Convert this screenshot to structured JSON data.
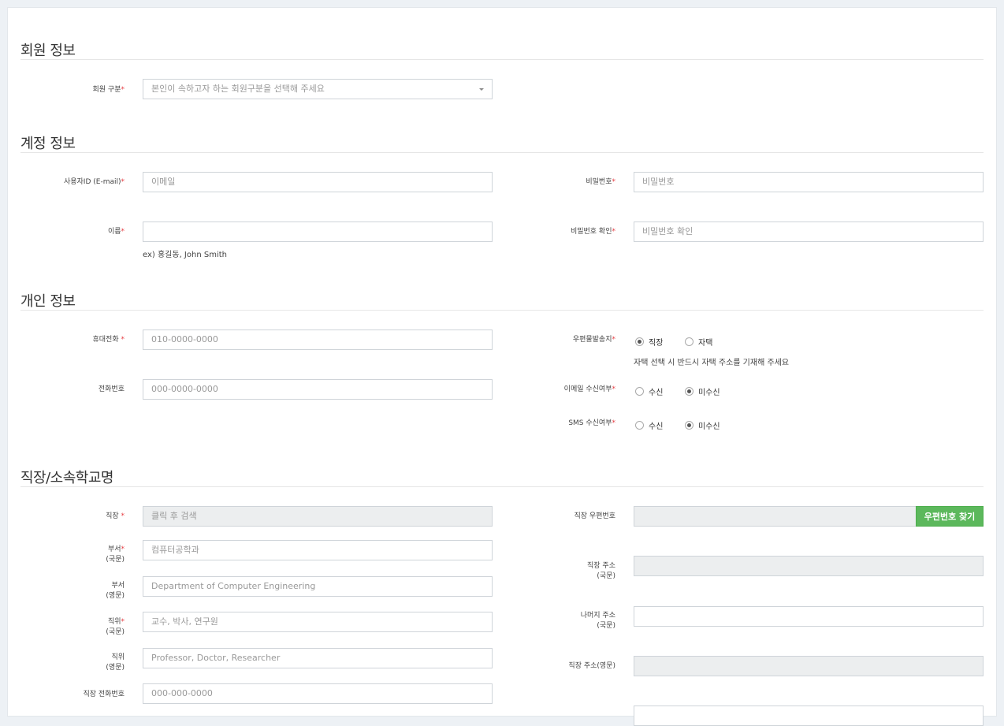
{
  "req_mark": "*",
  "sections": {
    "member": "회원 정보",
    "account": "계정 정보",
    "personal": "개인 정보",
    "workplace": "직장/소속학교명"
  },
  "member": {
    "type_label": "회원 구분",
    "type_select": "본인이 속하고자 하는 회원구분을 선택해 주세요"
  },
  "account": {
    "id_label": "사용자ID (E-mail)",
    "id_placeholder": "이메일",
    "name_label": "이름",
    "name_value": "",
    "name_hint": "ex) 홍길동, John Smith",
    "pw_label": "비밀번호",
    "pw_placeholder": "비밀번호",
    "pw_confirm_label": "비밀번호 확인",
    "pw_confirm_placeholder": "비밀번호 확인"
  },
  "personal": {
    "mobile_label": "휴대전화",
    "mobile_placeholder": "010-0000-0000",
    "phone_label": "전화번호",
    "phone_placeholder": "000-0000-0000",
    "mail_dest_label": "우편물발송지",
    "mail_dest_options": [
      "직장",
      "자택"
    ],
    "mail_dest_hint": "자택 선택 시 반드시 자택 주소를 기재해 주세요",
    "email_recv_label": "이메일 수신여부",
    "sms_recv_label": "SMS 수신여부",
    "recv_options": [
      "수신",
      "미수신"
    ]
  },
  "workplace": {
    "company_label": "직장",
    "company_placeholder": "클릭 후 검색",
    "dept_kr_label": "부서",
    "dept_kr_sub": "(국문)",
    "dept_kr_placeholder": "컴퓨터공학과",
    "dept_en_label": "부서",
    "dept_en_sub": "(영문)",
    "dept_en_placeholder": "Department of Computer Engineering",
    "pos_kr_label": "직위",
    "pos_kr_sub": "(국문)",
    "pos_kr_placeholder": "교수, 박사, 연구원",
    "pos_en_label": "직위",
    "pos_en_sub": "(영문)",
    "pos_en_placeholder": "Professor, Doctor, Researcher",
    "work_phone_label": "직장 전화번호",
    "work_phone_placeholder": "000-000-0000",
    "zip_label": "직장 우편번호",
    "zip_button": "우편번호 찾기",
    "addr_kr_label": "직장 주소",
    "addr_kr_sub": "(국문)",
    "addr_rest_label": "나머지 주소",
    "addr_rest_sub": "(국문)",
    "addr_en_label": "직장 주소(영문)"
  }
}
